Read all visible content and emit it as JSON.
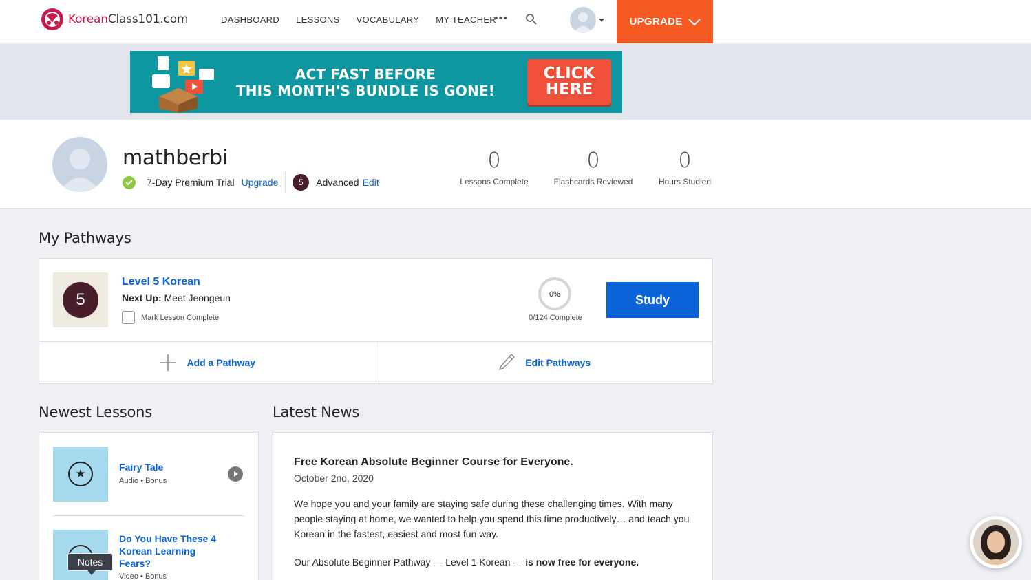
{
  "brand": {
    "logo_part1": "Korean",
    "logo_part2": "Class101.com"
  },
  "nav": {
    "items": [
      "DASHBOARD",
      "LESSONS",
      "VOCABULARY",
      "MY TEACHER"
    ],
    "more_label": "•••",
    "upgrade_label": "UPGRADE"
  },
  "banner": {
    "line1": "ACT FAST BEFORE",
    "line2": "THIS MONTH'S BUNDLE IS GONE!",
    "cta_line1": "CLICK",
    "cta_line2": "HERE"
  },
  "profile": {
    "username": "mathberbi",
    "trial_text": "7-Day Premium Trial",
    "upgrade_link": "Upgrade",
    "level_number": "5",
    "level_name": "Advanced",
    "edit_link": "Edit",
    "stats": [
      {
        "value": "0",
        "label": "Lessons Complete"
      },
      {
        "value": "0",
        "label": "Flashcards Reviewed"
      },
      {
        "value": "0",
        "label": "Hours Studied"
      }
    ]
  },
  "pathways": {
    "heading": "My Pathways",
    "level_badge": "5",
    "title": "Level 5 Korean",
    "next_up_label": "Next Up:",
    "next_up_value": "Meet Jeongeun",
    "mark_complete": "Mark Lesson Complete",
    "progress_percent": "0%",
    "progress_fraction": 0,
    "progress_label": "0/124 Complete",
    "study_label": "Study",
    "add_label": "Add a Pathway",
    "edit_label": "Edit Pathways"
  },
  "lessons": {
    "heading": "Newest Lessons",
    "items": [
      {
        "title": "Fairy Tale",
        "meta": "Audio • Bonus"
      },
      {
        "title": "Do You Have These 4 Korean Learning Fears?",
        "meta": "Video • Bonus"
      }
    ],
    "notes_tooltip": "Notes"
  },
  "news": {
    "heading": "Latest News",
    "title": "Free Korean Absolute Beginner Course for Everyone.",
    "date": "October 2nd, 2020",
    "body": "We hope you and your family are staying safe during these challenging times. With many people staying at home, we wanted to help you spend this time productively… and teach you Korean in the fastest, easiest and most fun way.",
    "body2_plain": "Our Absolute Beginner Pathway — Level 1 Korean — ",
    "body2_bold": "is now free for everyone."
  },
  "colors": {
    "accent_blue": "#0a64d8",
    "upgrade_orange": "#f55a22",
    "banner_teal": "#0d96a0",
    "level_maroon": "#4a1d2a",
    "check_green": "#8dc63f"
  },
  "icons": [
    "logo-icon",
    "search-icon",
    "chevron-down-icon",
    "check-icon",
    "plus-icon",
    "pencil-icon",
    "star-icon",
    "play-icon"
  ]
}
